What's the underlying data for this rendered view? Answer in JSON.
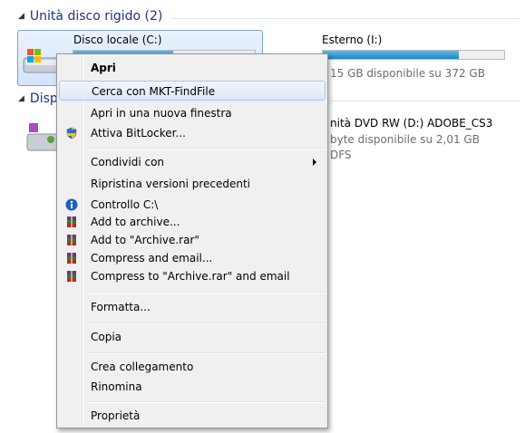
{
  "groups": {
    "hard_disks": "Unità disco rigido (2)",
    "removable_prefix": "Disp"
  },
  "drives": {
    "c": {
      "name": "Disco locale (C:)",
      "usage_fraction": 0.55
    },
    "e": {
      "name": "Esterno (I:)",
      "free_text": "15 GB disponibile su 372 GB",
      "usage_fraction": 0.75
    },
    "dvd": {
      "name": "nità DVD RW (D:) ADOBE_CS3",
      "free_text": "byte disponibile su 2,01 GB",
      "fs": "DFS"
    }
  },
  "menu": {
    "items": [
      {
        "id": "apri",
        "label": "Apri",
        "bold": true
      },
      {
        "id": "cerca",
        "label": "Cerca con MKT-FindFile",
        "hover": true
      },
      {
        "id": "nuova-finestra",
        "label": "Apri in una nuova finestra"
      },
      {
        "id": "bitlocker",
        "label": "Attiva BitLocker...",
        "icon": "shield-icon"
      },
      {
        "id": "condividi",
        "label": "Condividi con",
        "submenu": true
      },
      {
        "id": "ripristina",
        "label": "Ripristina versioni precedenti"
      },
      {
        "id": "controllo",
        "label": "Controllo C:\\",
        "icon": "info-icon"
      },
      {
        "id": "add-archive",
        "label": "Add to archive...",
        "icon": "winrar-icon"
      },
      {
        "id": "add-archive-rar",
        "label": "Add to \"Archive.rar\"",
        "icon": "winrar-icon"
      },
      {
        "id": "compress-email",
        "label": "Compress and email...",
        "icon": "winrar-icon"
      },
      {
        "id": "compress-rar-email",
        "label": "Compress to \"Archive.rar\" and email",
        "icon": "winrar-icon"
      },
      {
        "id": "formatta",
        "label": "Formatta..."
      },
      {
        "id": "copia",
        "label": "Copia"
      },
      {
        "id": "crea-collegamento",
        "label": "Crea collegamento"
      },
      {
        "id": "rinomina",
        "label": "Rinomina"
      },
      {
        "id": "proprieta",
        "label": "Proprietà"
      }
    ]
  }
}
